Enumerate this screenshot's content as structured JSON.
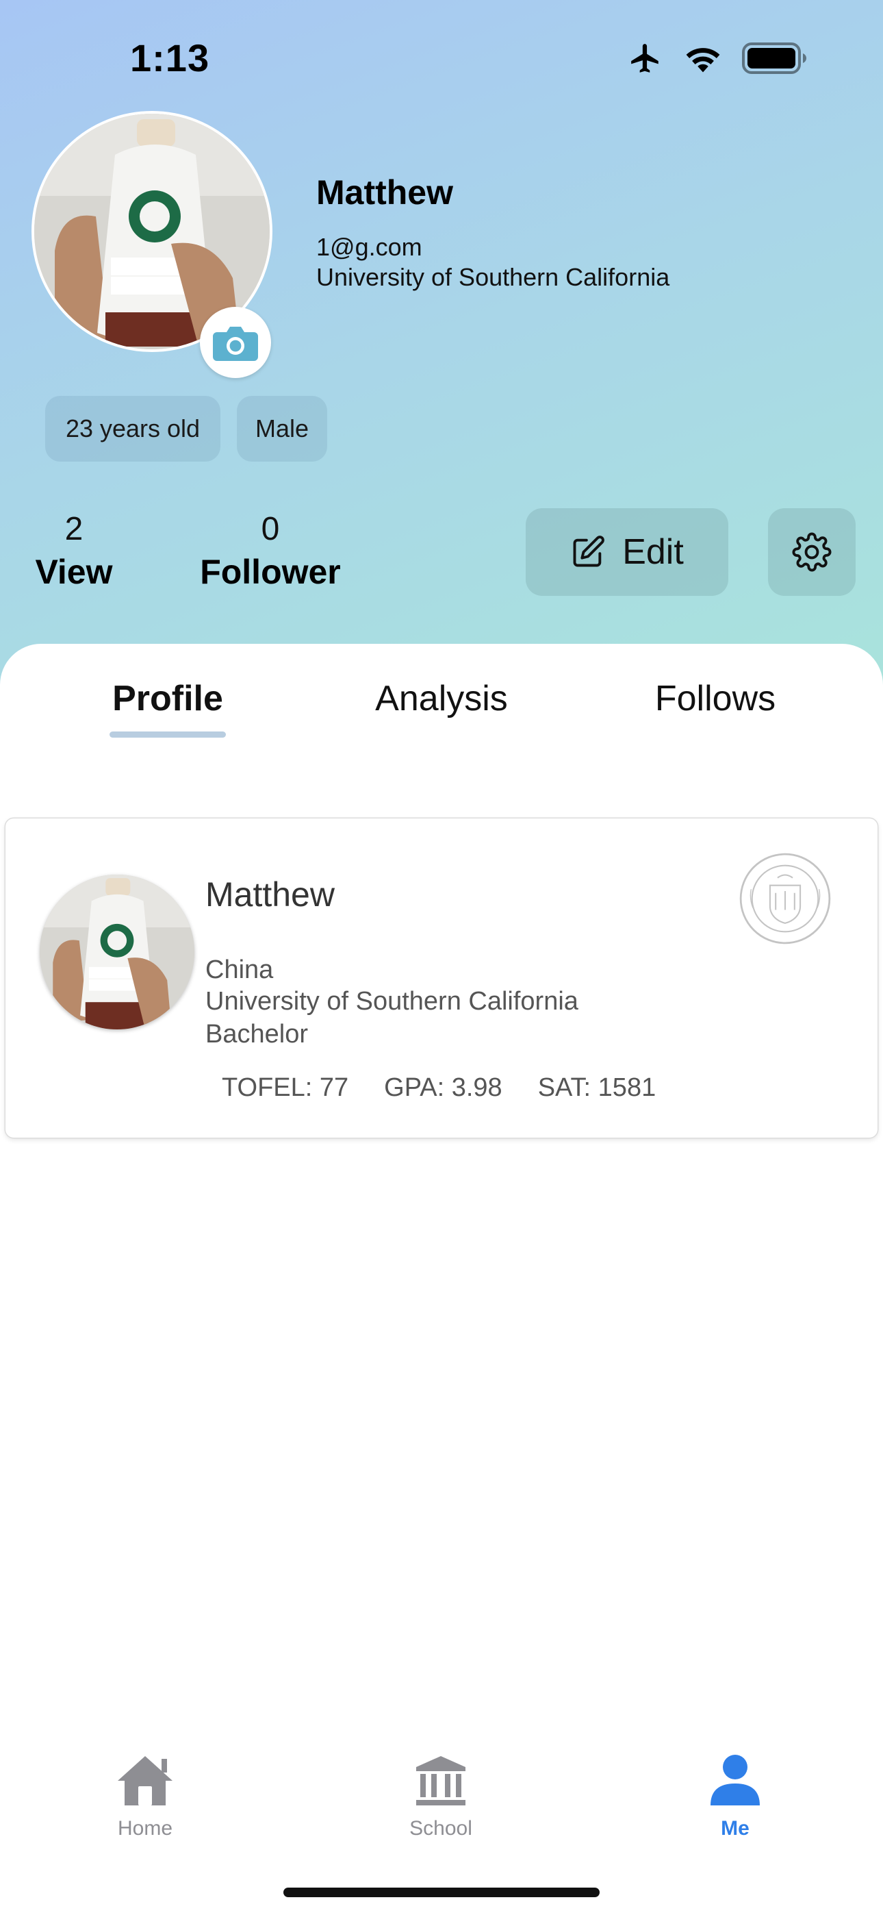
{
  "status_bar": {
    "time": "1:13",
    "icons": [
      "airplane-icon",
      "wifi-icon",
      "battery-icon"
    ]
  },
  "profile_header": {
    "name": "Matthew",
    "email": "1@g.com",
    "school": "University of Southern California",
    "tags": {
      "age": "23 years old",
      "gender": "Male"
    },
    "stats": {
      "view_count": "2",
      "view_label": "View",
      "follower_count": "0",
      "follower_label": "Follower"
    },
    "edit_label": "Edit"
  },
  "tabs": [
    {
      "label": "Profile",
      "active": true
    },
    {
      "label": "Analysis",
      "active": false
    },
    {
      "label": "Follows",
      "active": false
    }
  ],
  "profile_card": {
    "name": "Matthew",
    "country": "China",
    "school": "University of Southern California",
    "degree": "Bachelor",
    "scores": {
      "tofel": "TOFEL: 77",
      "gpa": "GPA: 3.98",
      "sat": "SAT: 1581"
    }
  },
  "tab_bar": [
    {
      "label": "Home",
      "icon": "home-icon",
      "active": false
    },
    {
      "label": "School",
      "icon": "school-icon",
      "active": false
    },
    {
      "label": "Me",
      "icon": "person-icon",
      "active": true
    }
  ],
  "colors": {
    "accent": "#2f7fe8",
    "tab_inactive": "#8e8e93",
    "header_gradient_start": "#a7c6f4",
    "header_gradient_end": "#a9e3dc",
    "tab_underline": "#b8cde0"
  }
}
